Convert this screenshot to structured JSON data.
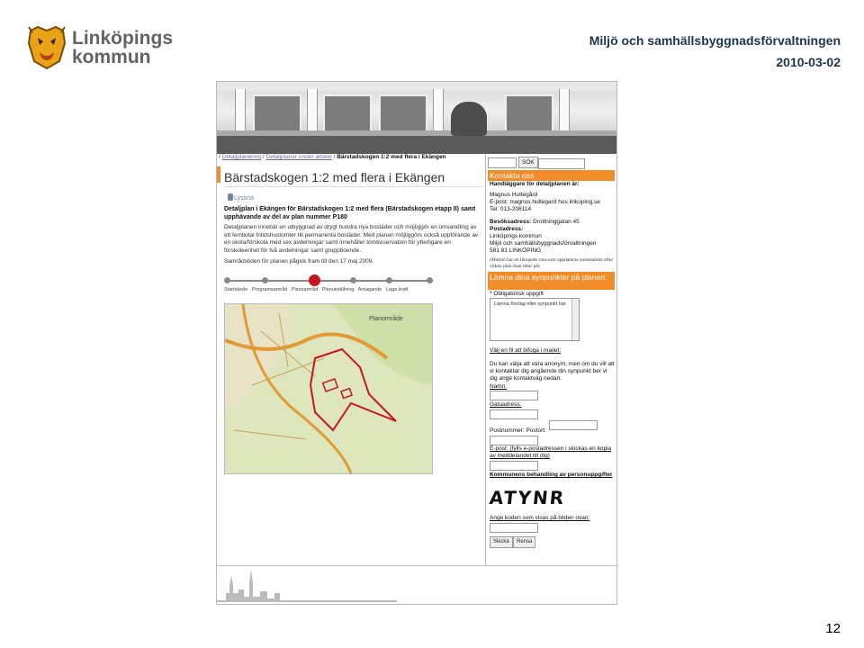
{
  "header": {
    "logo_line1": "Linköpings",
    "logo_line2": "kommun",
    "department": "Miljö och samhällsbyggnadsförvaltningen",
    "date": "2010-03-02",
    "page_number": "12"
  },
  "breadcrumb": {
    "sep": " / ",
    "items": [
      "Detaljplanering",
      "Detaljplaner under arbete"
    ],
    "current": "Bärstadskogen 1:2 med flera i Ekängen"
  },
  "main": {
    "title": "Bärstadskogen 1:2 med flera i Ekängen",
    "listen_label": "Lyssna",
    "lead": "Detaljplan i Ekängen för Bärstadskogen 1:2 med flera (Bärstadskogen etapp II) samt upphävande av del av plan nummer P180",
    "body1": "Detaljplanen innebär en utbyggnad av drygt hundra nya bostäder och möjliggör en omvandling av ett femtiotal fritidshustomter till permanenta bostäder. Med planen möjliggörs också uppförande av en skola/förskola med sex avdelningar samt innehåller tomtreservation för ytterligare en förskoleenhet för två avdelningar samt gruppboende.",
    "body2": "Samrådstiden för planen pågick fram till den 17 maj 2009.",
    "timeline_steps": [
      "Startskede",
      "Programsamråd",
      "Plansamråd",
      "Planutställning",
      "Antagande",
      "Laga kraft"
    ],
    "timeline_active_index": 2,
    "map_label": "Planområde"
  },
  "sidebar": {
    "search_button": "SÖK",
    "contact_heading": "Kontakta oss",
    "handler_label": "Handläggare för detaljplanen är:",
    "handler_name": "Magnus Hultegård",
    "handler_email": "E-post: magnus.hultegard hos linkoping.se",
    "handler_phone": "Tel: 013-206114",
    "visit_label": "Besöksadress:",
    "visit_address": "Drottninggatan 45",
    "postal_label": "Postadress:",
    "postal_line1": "Linköpings kommun",
    "postal_line2": "Miljö och samhällsbyggnadsförvaltningen",
    "postal_line3": "581 81 LINKÖPING",
    "note": "(Malmö har en liknande ruta som uppdateras automatiskt efter vilken plan man tittar på)",
    "feedback_heading": "Lämna dina synpunkter på planen:",
    "required_note": "* Obligatorisk uppgift",
    "textarea_placeholder": "Lämna förslag eller synpunkt här",
    "attach_link": "Välj en fil att bifoga i mailet:",
    "anon_text": "Du kan välja att vara anonym, men om du vill att vi kontaktar dig angående din synpunkt ber vi dig ange kontaktväg nedan.",
    "name_label": "Namn:",
    "street_label": "Gatuadress:",
    "postal_number_label": "Postnummer: Postort:",
    "email_label": "E-post: (fylls e-postadressen i skickas en kopia av meddelandet till dig)",
    "privacy_link": "Kommunens behandling av personuppgifter",
    "captcha_text": "ATYNR",
    "captcha_label": "Ange koden som visas på bilden ovan:",
    "send_button": "Skicka",
    "reset_button": "Rensa"
  },
  "colors": {
    "accent_orange": "#f28c28",
    "heading_blue": "#1b3550",
    "timeline_active": "#c8161d"
  }
}
